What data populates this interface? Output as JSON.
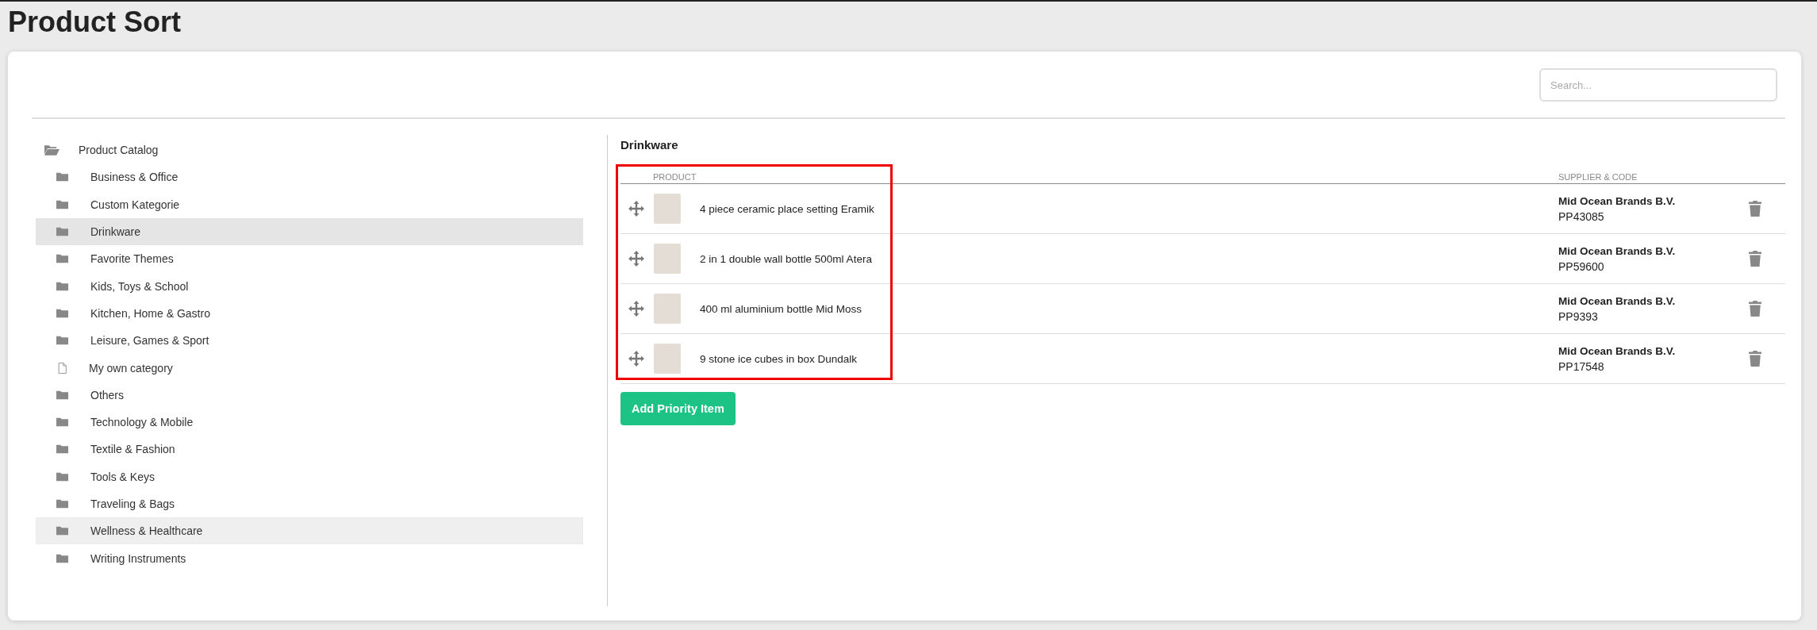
{
  "page": {
    "title": "Product Sort"
  },
  "search": {
    "placeholder": "Search..."
  },
  "tree": {
    "label": "Product Catalog",
    "kind": "folder",
    "expanded": true,
    "selected": false,
    "hovered": false,
    "children": [
      {
        "label": "Business & Office",
        "kind": "folder",
        "selected": false,
        "hovered": false
      },
      {
        "label": "Custom Kategorie",
        "kind": "folder",
        "selected": false,
        "hovered": false
      },
      {
        "label": "Drinkware",
        "kind": "folder",
        "selected": true,
        "hovered": false
      },
      {
        "label": "Favorite Themes",
        "kind": "folder",
        "selected": false,
        "hovered": false
      },
      {
        "label": "Kids, Toys & School",
        "kind": "folder",
        "selected": false,
        "hovered": false
      },
      {
        "label": "Kitchen, Home & Gastro",
        "kind": "folder",
        "selected": false,
        "hovered": false
      },
      {
        "label": "Leisure, Games & Sport",
        "kind": "folder",
        "selected": false,
        "hovered": false
      },
      {
        "label": "My own category",
        "kind": "file",
        "selected": false,
        "hovered": false
      },
      {
        "label": "Others",
        "kind": "folder",
        "selected": false,
        "hovered": false
      },
      {
        "label": "Technology & Mobile",
        "kind": "folder",
        "selected": false,
        "hovered": false
      },
      {
        "label": "Textile & Fashion",
        "kind": "folder",
        "selected": false,
        "hovered": false
      },
      {
        "label": "Tools & Keys",
        "kind": "folder",
        "selected": false,
        "hovered": false
      },
      {
        "label": "Traveling & Bags",
        "kind": "folder",
        "selected": false,
        "hovered": false
      },
      {
        "label": "Wellness & Healthcare",
        "kind": "folder",
        "selected": false,
        "hovered": true
      },
      {
        "label": "Writing Instruments",
        "kind": "folder",
        "selected": false,
        "hovered": false
      }
    ]
  },
  "panel": {
    "heading": "Drinkware",
    "highlight_frame": true,
    "columns": [
      "PRODUCT",
      "SUPPLIER & CODE"
    ],
    "rows": [
      {
        "product": "4 piece ceramic place setting Eramik",
        "supplier": "Mid Ocean Brands B.V.",
        "code": "PP43085"
      },
      {
        "product": "2 in 1 double wall bottle 500ml Atera",
        "supplier": "Mid Ocean Brands B.V.",
        "code": "PP59600"
      },
      {
        "product": "400 ml aluminium bottle Mid Moss",
        "supplier": "Mid Ocean Brands B.V.",
        "code": "PP9393"
      },
      {
        "product": "9 stone ice cubes in box Dundalk",
        "supplier": "Mid Ocean Brands B.V.",
        "code": "PP17548"
      }
    ],
    "add_button": "Add Priority Item"
  }
}
